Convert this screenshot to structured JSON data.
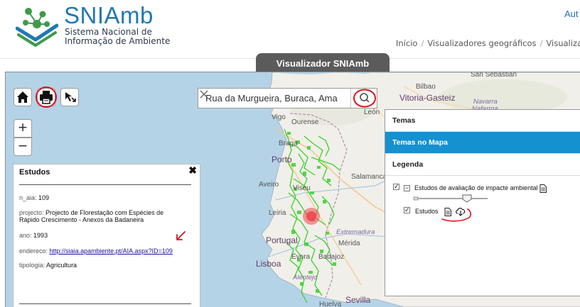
{
  "header": {
    "brand_title": "SNIAmb",
    "brand_subtitle_line1": "Sistema Nacional de",
    "brand_subtitle_line2": "Informação de Ambiente",
    "auth_link": "Aut",
    "breadcrumb": [
      "Início",
      "Visualizadores geográficos",
      "Visualiza"
    ]
  },
  "viewer_tab": "Visualizador SNIAmb",
  "toolbar": {
    "home_icon": "home-icon",
    "print_icon": "print-icon",
    "select_icon": "pointer-select-icon",
    "zoom_in": "+",
    "zoom_out": "−"
  },
  "search": {
    "value": "Rua da Murgueira, Buraca, Ama",
    "clear_icon": "clear-x-icon",
    "search_icon": "magnifier-icon"
  },
  "map_labels": {
    "sansebastian": "San Sebastián",
    "bilbao": "Bilbao",
    "vitoria": "Vitoria-Gasteiz",
    "navarra": "Navarra",
    "nafarroa": "Nafarroa",
    "leon": "León",
    "vigo": "Vigo",
    "ourense": "Ourense",
    "braga": "Braga",
    "porto": "Porto",
    "aveiro": "Aveiro",
    "viseu": "Viseu",
    "salamanca": "Salamanca",
    "leiria": "Leiria",
    "portugal": "Portugal",
    "extremadura": "Extremadura",
    "merida": "Mérida",
    "lisboa": "Lisboa",
    "evora": "Évora",
    "badajoz": "Badajoz",
    "alentejo": "Alentejo",
    "sevilla": "Sevilla",
    "huelva": "Huelva"
  },
  "popup": {
    "title": "Estudos",
    "close": "✖",
    "fields": {
      "n_aia_key": "n_aia:",
      "n_aia_val": "109",
      "projecto_key": "projecto:",
      "projecto_val_line1": "Projecto de Florestação com Espécies de",
      "projecto_val_line2": "Rápido Crescimento - Anexos da Badaneira",
      "ano_key": "ano:",
      "ano_val": "1993",
      "endereco_key": "endereco:",
      "endereco_val": "http://siaia.apambiente.pt/AIA.aspx?ID=109",
      "tipologia_key": "tipologia:",
      "tipologia_val": "Agricultura"
    }
  },
  "layers_panel": {
    "tabs": [
      "Temas",
      "Temas no Mapa",
      "Legenda"
    ],
    "active_tab": "Temas no Mapa",
    "group_label": "Estudos de avaliação de impacte ambiental",
    "layer_label": "Estudos",
    "group_checked": true,
    "layer_checked": true,
    "opacity": 0.75
  },
  "colors": {
    "brand_blue": "#1f78b4",
    "panel_active": "#1591d0",
    "study_polygons": "#39d12e",
    "marker": "#f0464e",
    "annotation_red": "#d8141a"
  }
}
